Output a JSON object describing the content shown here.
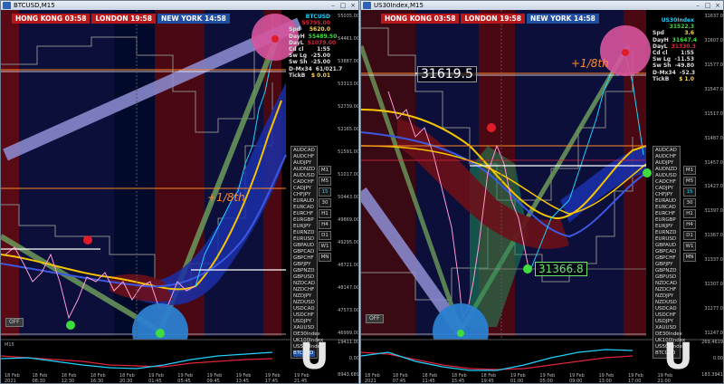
{
  "left": {
    "title": "BTCUSD,M15",
    "sessions": {
      "hk": "HONG KONG 03:58",
      "london": "LONDON 19:58",
      "ny": "NEW YORK 14:58"
    },
    "info_header": "BTCUSD",
    "info_big": "55795.00",
    "info": [
      {
        "k": "Spd",
        "v": "5620.0"
      },
      {
        "k": "DayH",
        "v": "55489.50"
      },
      {
        "k": "DayL",
        "v": "51079.00"
      },
      {
        "k": "Cd cl",
        "v": "1:55"
      },
      {
        "k": "Sw Lg",
        "v": "-25.00"
      },
      {
        "k": "Sw Sh",
        "v": "-25.00"
      },
      {
        "k": "D-Mx34",
        "v": "61/021.7"
      },
      {
        "k": "TickB",
        "v": "$ 0.01"
      }
    ],
    "eighth_label": "+1/8th",
    "symbols": [
      "AUDCAD",
      "AUDCHF",
      "AUDJPY",
      "AUDNZD",
      "AUDUSD",
      "CADCHF",
      "CADJPY",
      "CHFJPY",
      "EURAUD",
      "EURCAD",
      "EURCHF",
      "EURGBP",
      "EURJPY",
      "EURNZD",
      "EURUSD",
      "GBPAUD",
      "GBPCAD",
      "GBPCHF",
      "GBPJPY",
      "GBPNZD",
      "GBPUSD",
      "NZDCAD",
      "NZDCHF",
      "NZDJPY",
      "NZDUSD",
      "USDCAD",
      "USDCHF",
      "USDJPY",
      "XAUUSD",
      "DE30Index",
      "UK100Index",
      "US500Index",
      "BTCUSD"
    ],
    "active_symbol": "BTCUSD",
    "timeframes": [
      "M1",
      "M5",
      "15",
      "30",
      "H1",
      "H4",
      "D1",
      "W1",
      "MN"
    ],
    "active_tf": "15",
    "off_label": "OFF",
    "indicator_label": "M15",
    "u_label": "U",
    "yaxis": [
      "55035.00",
      "54461.00",
      "53887.00",
      "53313.00",
      "52739.00",
      "52165.00",
      "51591.00",
      "51017.00",
      "50443.00",
      "49869.00",
      "49295.00",
      "48721.00",
      "48147.00",
      "47573.00",
      "46999.00"
    ],
    "ind_yaxis": [
      "19411.00",
      "0.00",
      "8943.689"
    ],
    "xaxis": [
      "18 Feb 2021",
      "18 Feb 08:30",
      "18 Feb 12:30",
      "18 Feb 16:30",
      "18 Feb 20:30",
      "19 Feb 01:45",
      "19 Feb 05:45",
      "19 Feb 09:45",
      "19 Feb 13:45",
      "19 Feb 17:45",
      "19 Feb 21:45"
    ]
  },
  "right": {
    "title": "US30Index,M15",
    "sessions": {
      "hk": "HONG KONG 03:58",
      "london": "LONDON 19:58",
      "ny": "NEW YORK 14:58"
    },
    "info_header": "US30Index",
    "info_big": "31522.3",
    "info": [
      {
        "k": "Spd",
        "v": "3.6"
      },
      {
        "k": "DayH",
        "v": "31647.4"
      },
      {
        "k": "DayL",
        "v": "31330.3"
      },
      {
        "k": "Cd cl",
        "v": "1:55"
      },
      {
        "k": "Sw Lg",
        "v": "-11.53"
      },
      {
        "k": "Sw Sh",
        "v": "-49.80"
      },
      {
        "k": "D-Mx34",
        "v": "-52.3"
      },
      {
        "k": "TickB",
        "v": "$ 1.0"
      }
    ],
    "eighth_label": "+1/8th",
    "price_box_top": "31619.5",
    "price_box_low": "31366.8",
    "symbols": [
      "AUDCAD",
      "AUDCHF",
      "AUDJPY",
      "AUDNZD",
      "AUDUSD",
      "CADCHF",
      "CADJPY",
      "CHFJPY",
      "EURAUD",
      "EURCAD",
      "EURCHF",
      "EURGBP",
      "EURJPY",
      "EURNZD",
      "EURUSD",
      "GBPAUD",
      "GBPCAD",
      "GBPCHF",
      "GBPJPY",
      "GBPNZD",
      "GBPUSD",
      "NZDCAD",
      "NZDCHF",
      "NZDJPY",
      "NZDUSD",
      "USDCAD",
      "USDCHF",
      "USDJPY",
      "XAUUSD",
      "DE30Index",
      "UK100Index",
      "US500Index",
      "BTCUSD"
    ],
    "active_symbol": "US30Index",
    "timeframes": [
      "M1",
      "M5",
      "15",
      "30",
      "H1",
      "H4",
      "D1",
      "W1",
      "MN"
    ],
    "active_tf": "15",
    "off_label": "OFF",
    "u_label": "U",
    "yaxis": [
      "31637.0",
      "31607.0",
      "31577.0",
      "31547.0",
      "31517.0",
      "31487.0",
      "31457.0",
      "31427.0",
      "31397.0",
      "31367.0",
      "31337.0",
      "31307.0",
      "31277.0",
      "31247.0"
    ],
    "ind_yaxis": [
      "269.4619",
      "0.00",
      "183.3941"
    ],
    "xaxis": [
      "18 Feb 2021",
      "18 Feb 07:45",
      "18 Feb 11:45",
      "18 Feb 15:45",
      "18 Feb 19:45",
      "19 Feb 01:00",
      "19 Feb 05:00",
      "19 Feb 09:00",
      "19 Feb 13:00",
      "19 Feb 17:00",
      "19 Feb 21:00"
    ]
  },
  "colors": {
    "accent": "#1fd2ff",
    "bull": "#1fd2ff",
    "bear": "#ff9ad6",
    "ma_fast": "#f5c400",
    "ma_slow": "#2f4bd6",
    "session_red": "#b8181b",
    "session_blue": "#1f4fa0",
    "magenta_circle": "#d6549c",
    "blue_circle": "#2b7fd0"
  }
}
